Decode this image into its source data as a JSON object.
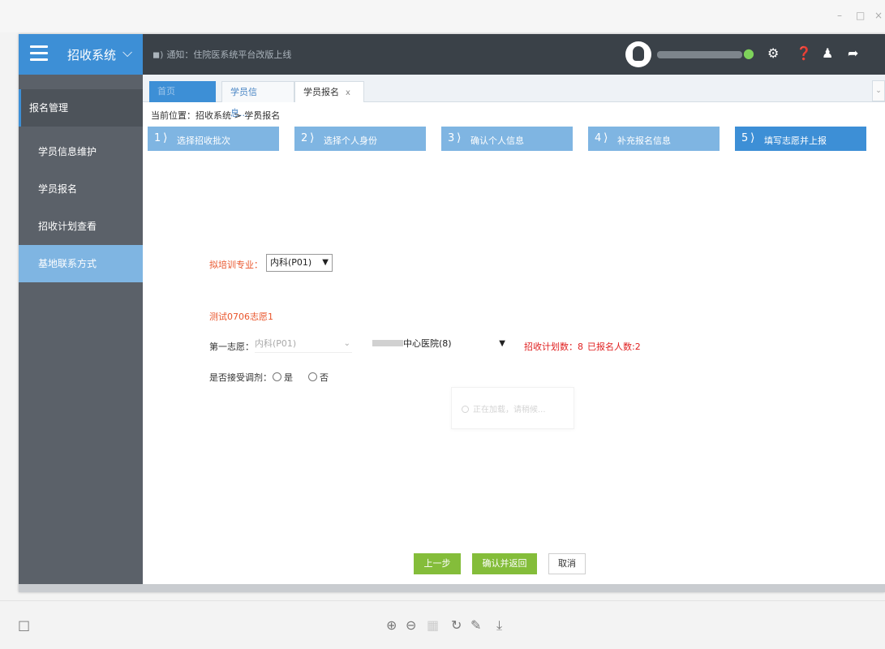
{
  "window": {
    "minimize": "–",
    "maximize": "□",
    "close": "×"
  },
  "brand": {
    "title": "招收系统",
    "caret": "⌵"
  },
  "notice": {
    "text": "通知：住院医系统平台改版上线"
  },
  "user": {
    "name": ""
  },
  "topbar_icons": [
    "wechat-icon",
    "gear-icon",
    "help-icon",
    "user-switch-icon",
    "logout-icon"
  ],
  "sidebar": {
    "group": "报名管理",
    "items": [
      {
        "label": "学员信息维护"
      },
      {
        "label": "学员报名"
      },
      {
        "label": "招收计划查看"
      },
      {
        "label": "基地联系方式"
      }
    ]
  },
  "tabs": [
    {
      "label": "首页"
    },
    {
      "label": "学员信息...",
      "close": "x"
    },
    {
      "label": "学员报名",
      "close": "x"
    }
  ],
  "breadcrumb": "当前位置：招收系统 > 学员报名",
  "steps": [
    {
      "num": "1",
      "label": "选择招收批次"
    },
    {
      "num": "2",
      "label": "选择个人身份"
    },
    {
      "num": "3",
      "label": "确认个人信息"
    },
    {
      "num": "4",
      "label": "补充报名信息"
    },
    {
      "num": "5",
      "label": "填写志愿并上报"
    }
  ],
  "form": {
    "major_label": "拟培训专业：",
    "major_value": "内科(P01)",
    "wish_title": "测试0706志愿1",
    "first_wish_label": "第一志愿：",
    "first_wish_major": "内科(P01)",
    "first_wish_hospital": "中心医院(8)",
    "plan_count": "招收计划数：8",
    "applied_count": "已报名人数:2",
    "adjust_label": "是否接受调剂：",
    "adjust_yes": "是",
    "adjust_no": "否",
    "loading_text": "正在加载，请稍候..."
  },
  "buttons": {
    "prev": "上一步",
    "confirm": "确认并返回",
    "cancel": "取消"
  },
  "colors": {
    "accent": "#3d8fd6",
    "step_inactive": "#7fb5e2",
    "orange": "#e9552b",
    "green": "#84bd3a",
    "red": "#e02020"
  }
}
